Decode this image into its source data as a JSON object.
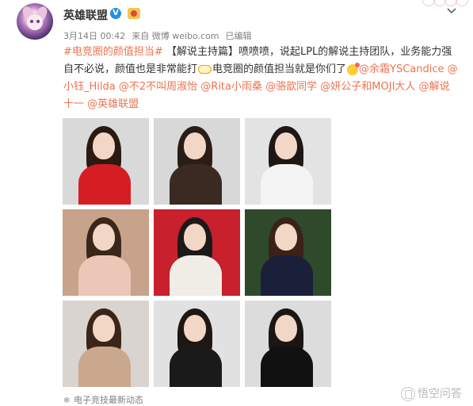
{
  "post": {
    "username": "英雄联盟",
    "vip_badge": "V",
    "timestamp": "3月14日 00:42",
    "source": "来自 微博 weibo.com",
    "edited": "已编辑",
    "hashtag": "#电竞圈的颜值担当#",
    "text_1": "【解说主持篇】",
    "text_2": "喷喷喷，说起LPL的解说主持团队，业务能力强自不必说，颜值也是非常能打",
    "text_3": "电竞圈的颜值担当就是你们了",
    "mentions": [
      "@余霜YSCandice",
      "@小钰_Hilda",
      "@不2不叫周淑怡",
      "@Rita小雨桑",
      "@骆歆同学",
      "@妍公子和MOJI大人",
      "@解说十一",
      "@英雄联盟"
    ]
  },
  "photos": [
    {
      "name": "photo-red-dress",
      "bg": "#d9d9d9",
      "outfit": "#d41e24",
      "hair": "#2a1a12"
    },
    {
      "name": "photo-smile-flower",
      "bg": "#d8d8d8",
      "outfit": "#3a2a22",
      "hair": "#2b1d16"
    },
    {
      "name": "photo-white-sweater",
      "bg": "#e3e3e3",
      "outfit": "#f4f4f4",
      "hair": "#1e1714"
    },
    {
      "name": "photo-warm-room",
      "bg": "#c8a28a",
      "outfit": "#ecc6b7",
      "hair": "#3a261b"
    },
    {
      "name": "photo-red-background",
      "bg": "#c8202c",
      "outfit": "#f0ede6",
      "hair": "#1c1a18"
    },
    {
      "name": "photo-green-leaves",
      "bg": "#2f4a2a",
      "outfit": "#1a1f3a",
      "hair": "#3b2218"
    },
    {
      "name": "photo-beige-top",
      "bg": "#d9d4cf",
      "outfit": "#c9a88e",
      "hair": "#3a2518"
    },
    {
      "name": "photo-black-pink-dress",
      "bg": "#e1e1e1",
      "outfit": "#1a1a1a",
      "hair": "#1e1714"
    },
    {
      "name": "photo-black-ruffle",
      "bg": "#dcdcdc",
      "outfit": "#111111",
      "hair": "#1b1513"
    }
  ],
  "footer": {
    "topic": "电子竞技最新动态",
    "watermark": "悟空问答"
  }
}
